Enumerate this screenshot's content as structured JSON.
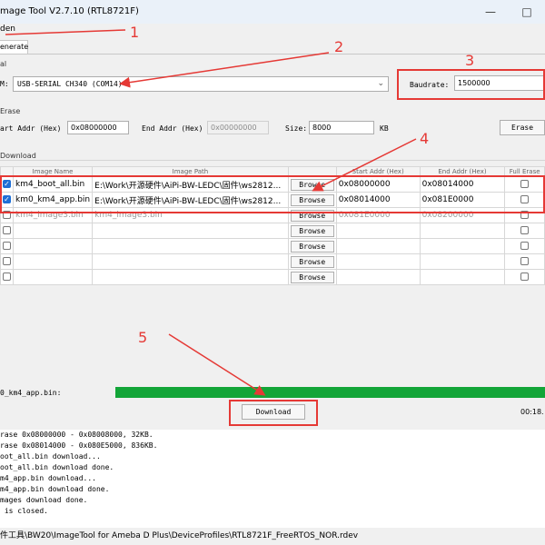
{
  "window": {
    "title": "mage Tool V2.7.10 (RTL8721F)",
    "minimize_icon": "minimize-icon",
    "maximize_icon": "maximize-icon"
  },
  "menu": {
    "first_item": "den"
  },
  "tabs": [
    {
      "label": "enerate"
    }
  ],
  "serial": {
    "group_label": "al",
    "port_label": "M:",
    "port_value": "USB-SERIAL CH340 (COM14)",
    "baudrate_label": "Baudrate:",
    "baudrate_value": "1500000"
  },
  "erase": {
    "group_label": "Erase",
    "start_label": "art Addr (Hex)",
    "start_value": "0x08000000",
    "end_label": "End Addr (Hex)",
    "end_value": "0x00000000",
    "size_label": "Size:",
    "size_value": "8000",
    "size_unit": "KB",
    "button": "Erase"
  },
  "download_group": {
    "label": "Download",
    "columns": [
      "Image Name",
      "Image Path",
      "Start Addr (Hex)",
      "End Addr (Hex)",
      "Full Erase"
    ],
    "browse_label": "Browse",
    "rows": [
      {
        "checked": true,
        "name": "km4_boot_all.bin",
        "path": "E:\\Work\\开源硬件\\AiPi-BW-LEDC\\固件\\ws2812...",
        "browse": "Browse",
        "start": "0x08000000",
        "end": "0x08014000",
        "enabled": true
      },
      {
        "checked": true,
        "name": "km0_km4_app.bin",
        "path": "E:\\Work\\开源硬件\\AiPi-BW-LEDC\\固件\\ws2812...",
        "browse": "Browse",
        "start": "0x08014000",
        "end": "0x081E0000",
        "enabled": true
      },
      {
        "checked": false,
        "name": "km4_image3.bin",
        "path": "km4_image3.bin",
        "browse": "Browse",
        "start": "0x081E0000",
        "end": "0x08200000",
        "enabled": false
      },
      {
        "checked": false,
        "name": "",
        "path": "",
        "browse": "Browse",
        "start": "",
        "end": "",
        "enabled": false
      },
      {
        "checked": false,
        "name": "",
        "path": "",
        "browse": "Browse",
        "start": "",
        "end": "",
        "enabled": false
      },
      {
        "checked": false,
        "name": "",
        "path": "",
        "browse": "Browse",
        "start": "",
        "end": "",
        "enabled": false
      },
      {
        "checked": false,
        "name": "",
        "path": "",
        "browse": "Browse",
        "start": "",
        "end": "",
        "enabled": false
      }
    ]
  },
  "progress": {
    "file_label": "0_km4_app.bin:",
    "value": 1.0,
    "color": "#13a538",
    "time": "00:18."
  },
  "download_button": "Download",
  "log_lines": [
    "rase 0x08000000 - 0x08008000, 32KB.",
    "rase 0x08014000 - 0x080E5000, 836KB.",
    "oot_all.bin download...",
    "oot_all.bin download done.",
    "m4_app.bin download...",
    "m4_app.bin download done.",
    "mages download done.",
    " is closed."
  ],
  "status_path": "件工具\\BW20\\ImageTool for Ameba D Plus\\DeviceProfiles\\RTL8721F_FreeRTOS_NOR.rdev",
  "annotations": {
    "n1": "1",
    "n2": "2",
    "n3": "3",
    "n4": "4",
    "n5": "5",
    "color": "#e53935"
  }
}
